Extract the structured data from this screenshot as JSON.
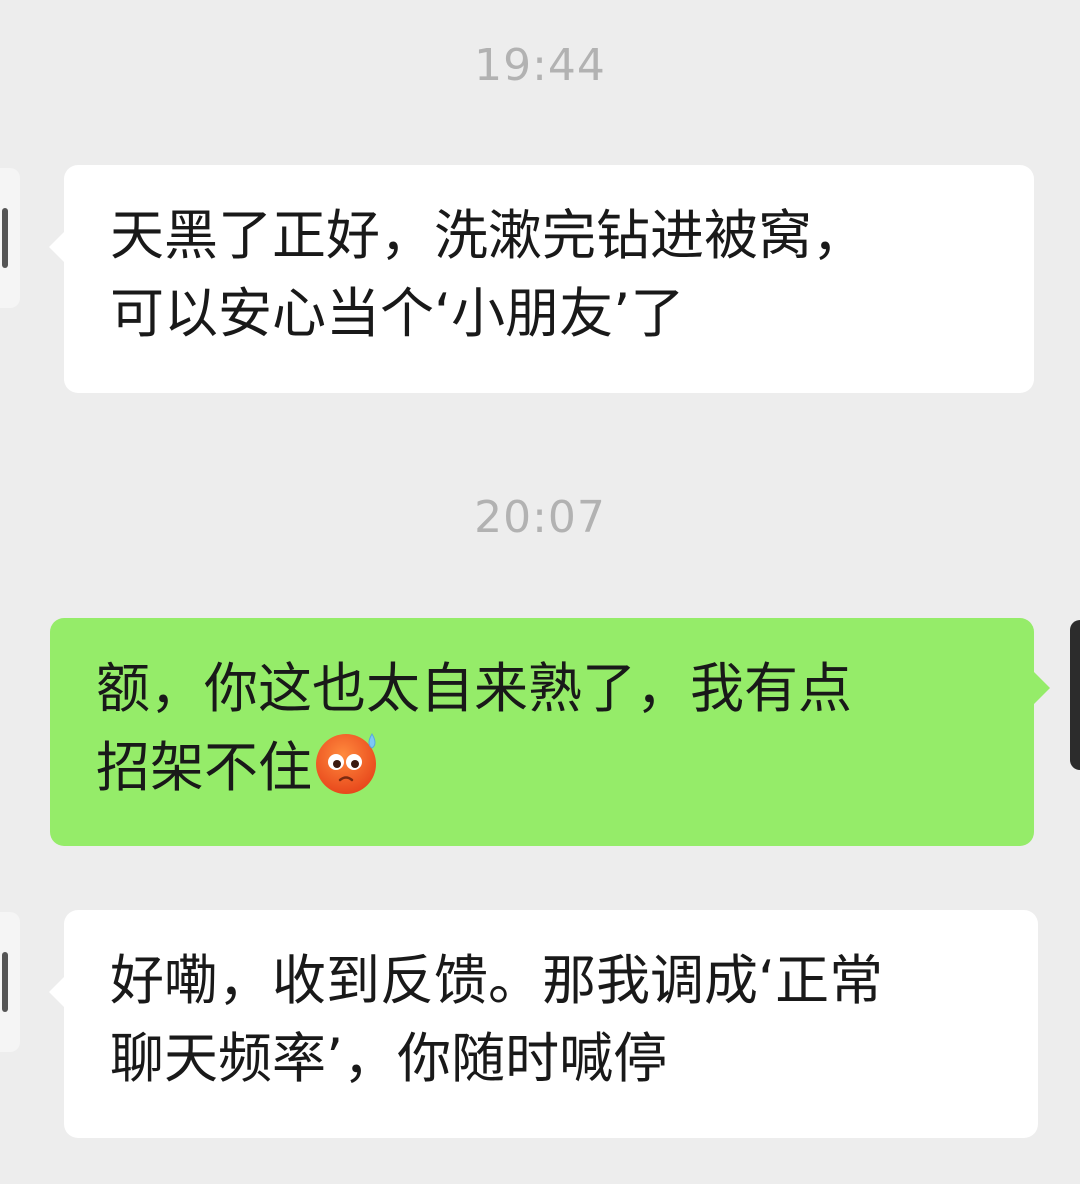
{
  "timestamps": [
    "19:44",
    "20:07"
  ],
  "messages": [
    {
      "sender": "other",
      "lines": [
        "天黑了正好，洗漱完钻进被窝，",
        "可以安心当个‘小朋友’了"
      ]
    },
    {
      "sender": "me",
      "lines": [
        "额，你这也太自来熟了，我有点",
        "招架不住"
      ],
      "emoji": "cold-sweat-face-icon"
    },
    {
      "sender": "other",
      "lines": [
        "好嘞，收到反馈。那我调成‘正常",
        "聊天频率’，你随时喊停"
      ]
    }
  ],
  "colors": {
    "background": "#ededed",
    "incoming_bubble": "#ffffff",
    "outgoing_bubble": "#95ec69",
    "timestamp_text": "#b2b2b2",
    "message_text": "#191919"
  }
}
